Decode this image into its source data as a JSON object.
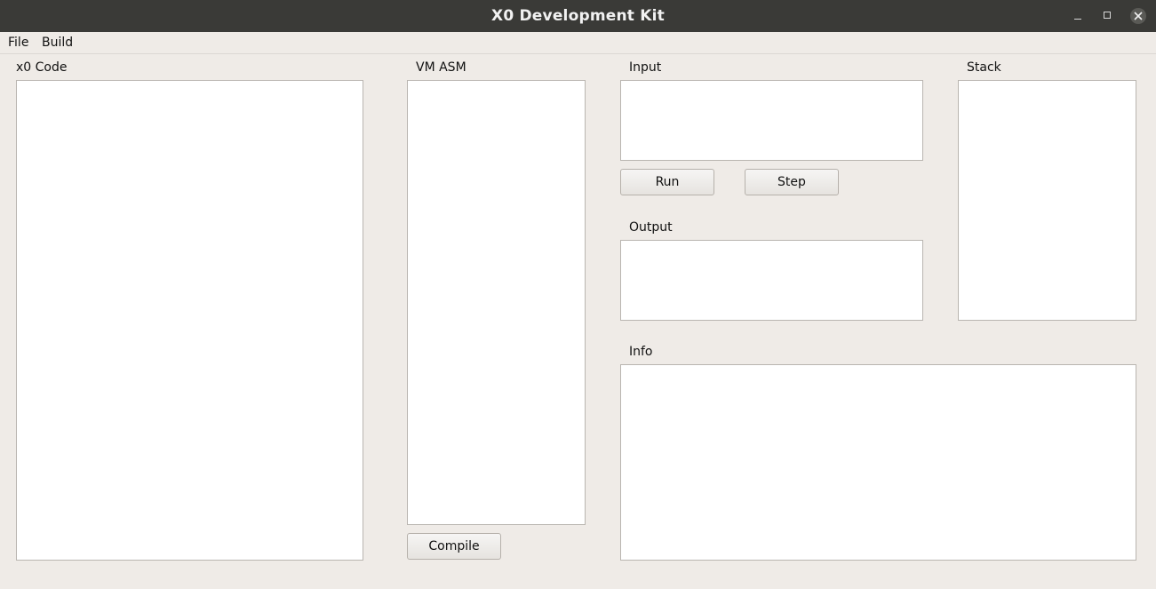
{
  "window": {
    "title": "X0 Development Kit",
    "controls": {
      "minimize_icon": "minimize-icon",
      "maximize_icon": "maximize-icon",
      "close_icon": "close-icon"
    }
  },
  "menubar": {
    "items": [
      {
        "label": "File"
      },
      {
        "label": "Build"
      }
    ]
  },
  "panels": {
    "code": {
      "label": "x0 Code",
      "value": ""
    },
    "vm_asm": {
      "label": "VM ASM",
      "value": ""
    },
    "input": {
      "label": "Input",
      "value": ""
    },
    "output": {
      "label": "Output",
      "value": ""
    },
    "stack": {
      "label": "Stack",
      "value": ""
    },
    "info": {
      "label": "Info",
      "value": ""
    }
  },
  "buttons": {
    "compile": "Compile",
    "run": "Run",
    "step": "Step"
  },
  "colors": {
    "titlebar": "#3a3a37",
    "background": "#efebe7",
    "field": "#ffffff"
  }
}
